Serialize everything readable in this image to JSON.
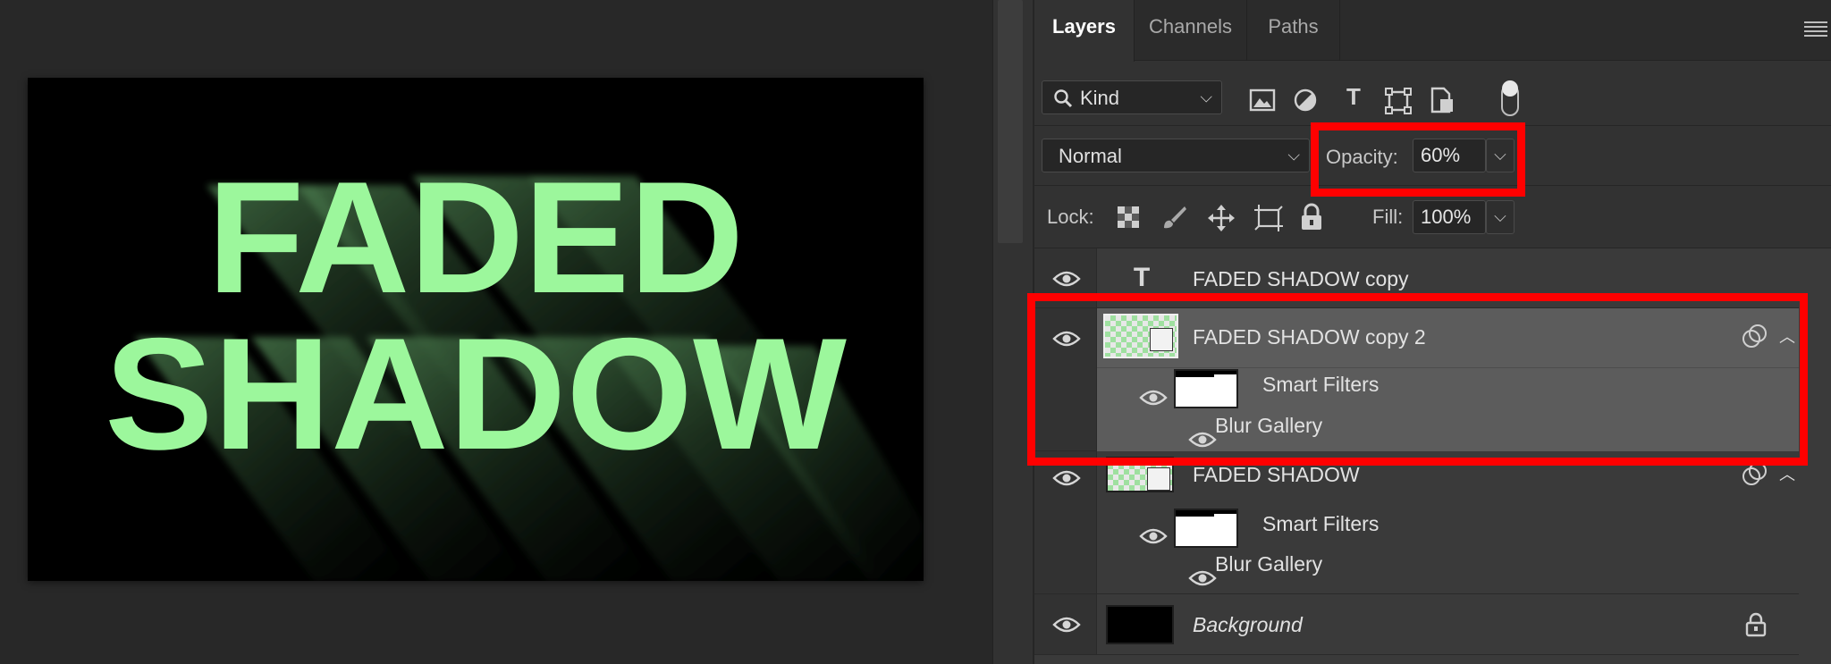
{
  "canvas": {
    "line1": "FADED",
    "line2": "SHADOW",
    "text_color": "#9cf79c"
  },
  "panel": {
    "tabs": [
      {
        "label": "Layers",
        "active": true
      },
      {
        "label": "Channels",
        "active": false
      },
      {
        "label": "Paths",
        "active": false
      }
    ],
    "filter": {
      "kind_label": "Kind"
    },
    "blend": {
      "mode": "Normal",
      "opacity_label": "Opacity:",
      "opacity_value": "60%"
    },
    "lock": {
      "lock_label": "Lock:",
      "fill_label": "Fill:",
      "fill_value": "100%"
    }
  },
  "layers": [
    {
      "name": "FADED SHADOW copy",
      "type": "text",
      "selected": false
    },
    {
      "name": "FADED SHADOW copy 2",
      "type": "smart-object",
      "selected": true,
      "filters_label": "Smart Filters",
      "filter_name": "Blur Gallery"
    },
    {
      "name": "FADED SHADOW",
      "type": "smart-object",
      "selected": false,
      "filters_label": "Smart Filters",
      "filter_name": "Blur Gallery"
    },
    {
      "name": "Background",
      "type": "background",
      "selected": false
    }
  ],
  "colors": {
    "highlight": "#ff0000",
    "selected_row": "#5c5c5c"
  }
}
